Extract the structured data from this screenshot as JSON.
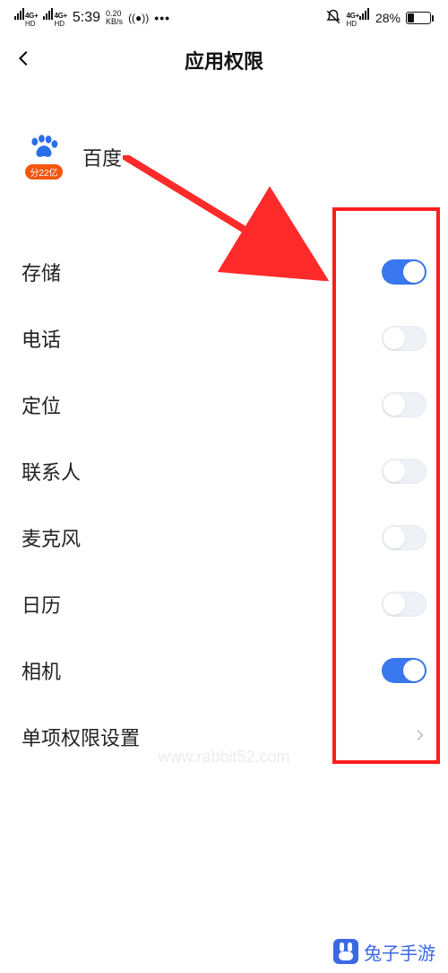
{
  "status": {
    "net_label_1": "4G+",
    "net_sub_1": "HD",
    "net_label_2": "4G+",
    "net_sub_2": "HD",
    "time": "5:39",
    "data_rate_top": "0.20",
    "data_rate_bot": "KB/s",
    "net_label_right": "4G+",
    "net_sub_right": "HD",
    "battery_pct": "28%"
  },
  "header": {
    "page_title": "应用权限"
  },
  "app": {
    "name": "百度",
    "badge": "分22亿"
  },
  "permissions": {
    "storage": {
      "label": "存储",
      "on": true
    },
    "phone": {
      "label": "电话",
      "on": false
    },
    "location": {
      "label": "定位",
      "on": false
    },
    "contacts": {
      "label": "联系人",
      "on": false
    },
    "microphone": {
      "label": "麦克风",
      "on": false
    },
    "calendar": {
      "label": "日历",
      "on": false
    },
    "camera": {
      "label": "相机",
      "on": true
    },
    "detail": {
      "label": "单项权限设置"
    }
  },
  "watermark": "www.rabbit52.com",
  "banner": "兔子手游"
}
